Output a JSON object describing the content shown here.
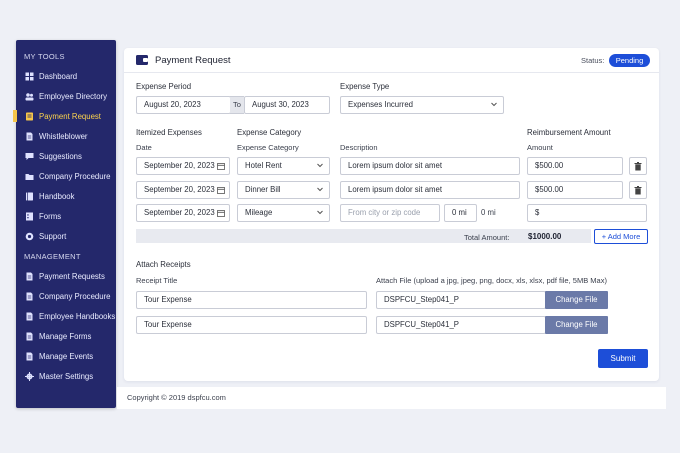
{
  "sidebar": {
    "tools_heading": "MY TOOLS",
    "tools": [
      {
        "label": "Dashboard",
        "icon": "dashboard-icon"
      },
      {
        "label": "Employee Directory",
        "icon": "people-icon"
      },
      {
        "label": "Payment Request",
        "icon": "receipt-icon",
        "active": true
      },
      {
        "label": "Whistleblower",
        "icon": "document-icon"
      },
      {
        "label": "Suggestions",
        "icon": "chat-icon"
      },
      {
        "label": "Company Procedure",
        "icon": "folder-icon"
      },
      {
        "label": "Handbook",
        "icon": "book-icon"
      },
      {
        "label": "Forms",
        "icon": "form-icon"
      },
      {
        "label": "Support",
        "icon": "support-icon"
      }
    ],
    "management_heading": "MANAGEMENT",
    "management": [
      {
        "label": "Payment Requests",
        "icon": "document-icon"
      },
      {
        "label": "Company Procedure",
        "icon": "document-icon"
      },
      {
        "label": "Employee Handbooks",
        "icon": "document-icon"
      },
      {
        "label": "Manage Forms",
        "icon": "document-icon"
      },
      {
        "label": "Manage Events",
        "icon": "document-icon"
      },
      {
        "label": "Master Settings",
        "icon": "gear-icon"
      }
    ]
  },
  "header": {
    "title": "Payment Request",
    "status_label": "Status:",
    "status_value": "Pending",
    "status_color": "#1d4ed8"
  },
  "period": {
    "label": "Expense Period",
    "from": "August 20, 2023",
    "to_label": "To",
    "to": "August 30, 2023"
  },
  "expense_type": {
    "label": "Expense Type",
    "value": "Expenses Incurred"
  },
  "itemized": {
    "heading": "Itemized Expenses",
    "col_date": "Date",
    "col_category_heading": "Expense Category",
    "col_category": "Expense Category",
    "col_description": "Description",
    "col_amount_heading": "Reimbursement Amount",
    "col_amount": "Amount",
    "rows": [
      {
        "date": "September 20, 2023",
        "category": "Hotel Rent",
        "description": "Lorem ipsum dolor sit amet",
        "amount": "$500.00"
      },
      {
        "date": "September 20, 2023",
        "category": "Dinner Bill",
        "description": "Lorem ipsum dolor sit amet",
        "amount": "$500.00"
      }
    ],
    "mileage_row": {
      "date": "September 20, 2023",
      "category": "Mileage",
      "location_placeholder": "From city or zip code",
      "miles_input": "0 mi",
      "miles_text": "0 mi",
      "amount": "$"
    },
    "total_label": "Total Amount:",
    "total_value": "$1000.00",
    "add_more": "+ Add More"
  },
  "receipts": {
    "heading": "Attach Receipts",
    "title_label": "Receipt Title",
    "file_label": "Attach File  (upload a jpg, jpeg, png, docx, xls, xlsx, pdf file, 5MB Max)",
    "rows": [
      {
        "title": "Tour Expense",
        "file": "DSPFCU_Step041_P",
        "button": "Change File"
      },
      {
        "title": "Tour Expense",
        "file": "DSPFCU_Step041_P",
        "button": "Change File"
      }
    ]
  },
  "submit_label": "Submit",
  "footer": "Copyright © 2019 dspfcu.com"
}
